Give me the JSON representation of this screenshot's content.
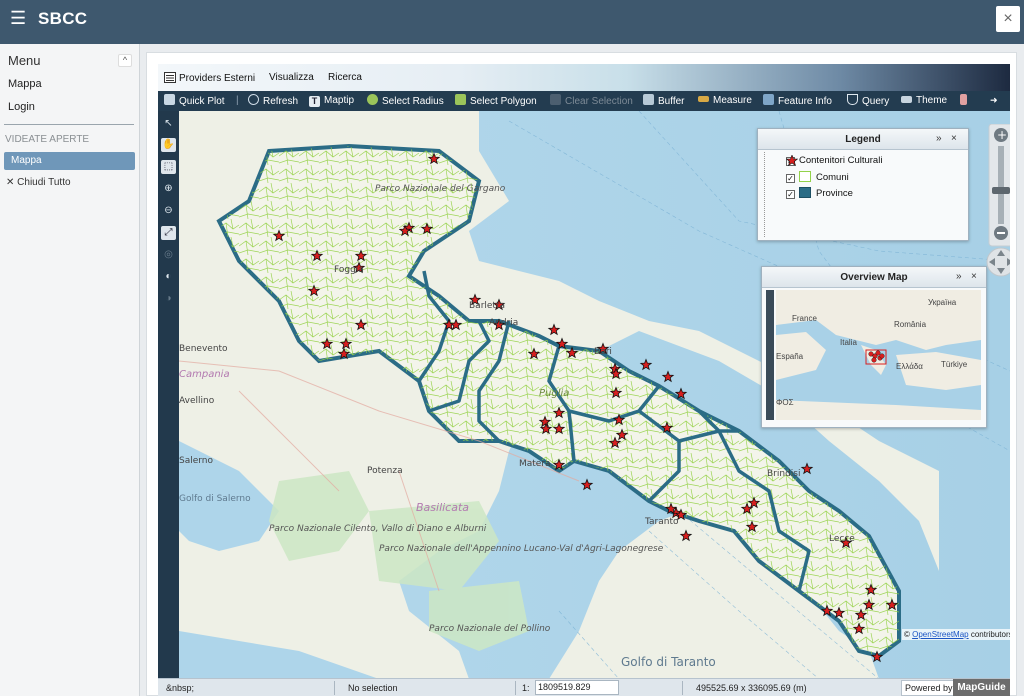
{
  "app": {
    "title": "SBCC",
    "menu_icon": "hamburger-icon",
    "close_icon": "×"
  },
  "sidebar": {
    "menu_label": "Menu",
    "collapse_icon": "^",
    "items": [
      {
        "label": "Mappa"
      },
      {
        "label": "Login"
      }
    ],
    "section_label": "VIDEATE APERTE",
    "open_item": "Mappa",
    "close_all_icon": "✕",
    "close_all": "Chiudi Tutto"
  },
  "viewer": {
    "menu": [
      "Providers Esterni",
      "Visualizza",
      "Ricerca"
    ],
    "toolbar": [
      {
        "label": "Quick Plot",
        "enabled": true
      },
      {
        "label": "Refresh",
        "enabled": true
      },
      {
        "label": "Maptip",
        "enabled": true
      },
      {
        "label": "Select Radius",
        "enabled": true
      },
      {
        "label": "Select Polygon",
        "enabled": true
      },
      {
        "label": "Clear Selection",
        "enabled": false
      },
      {
        "label": "Buffer",
        "enabled": true
      },
      {
        "label": "Measure",
        "enabled": true
      },
      {
        "label": "Feature Info",
        "enabled": true
      },
      {
        "label": "Query",
        "enabled": true
      },
      {
        "label": "Theme",
        "enabled": true
      }
    ],
    "toolbar_overflow": "➜",
    "legend": {
      "title": "Legend",
      "layers": [
        {
          "name": "Contenitori Culturali",
          "checked": true,
          "symbol": "red-star"
        },
        {
          "name": "Comuni",
          "checked": true,
          "symbol": "green-outline-square"
        },
        {
          "name": "Province",
          "checked": true,
          "symbol": "blue-square"
        }
      ]
    },
    "overview": {
      "title": "Overview Map",
      "labels": [
        "France",
        "Україна",
        "România",
        "Italia",
        "España",
        "Türkiye",
        "Ελλάδα",
        "ΦΟΣ"
      ]
    },
    "panel_buttons": {
      "collapse": "»",
      "close": "×"
    },
    "map_labels": [
      "Parco Nazionale del Gargano",
      "Foggia",
      "Barletta",
      "Andria",
      "Bari",
      "Puglia",
      "Matera",
      "Taranto",
      "Brindisi",
      "Lecce",
      "Potenza",
      "Basilicata",
      "Benevento",
      "Campania",
      "Avellino",
      "Salerno",
      "Parco Nazionale Cilento, Vallo di Diano e Alburni",
      "Parco Nazionale dell'Appennino Lucano-Val d'Agri-Lagonegrese",
      "Parco Nazionale del Pollino",
      "Golfo di Taranto",
      "Golfo di Salerno"
    ],
    "attribution": {
      "prefix": "© ",
      "link": "OpenStreetMap",
      "suffix": " contributors"
    },
    "status": {
      "left": "&nbsp;",
      "selection": "No selection",
      "scale_prefix": "1:",
      "scale_value": "1809519.829",
      "extent": "495525.69 x 336095.69 (m)",
      "powered": "Powered by",
      "brand": "MapGuide"
    }
  },
  "colors": {
    "topbar": "#3e586e",
    "toolbar": "#233c50",
    "province_outline": "#2b6c86",
    "comuni": "#93d24a",
    "star": "#d71f1f",
    "sea": "#a9d3e8"
  }
}
